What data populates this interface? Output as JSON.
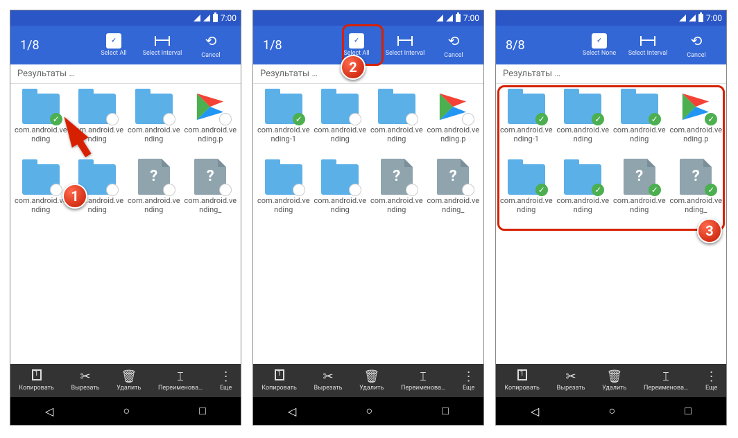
{
  "status": {
    "time": "7:00"
  },
  "toolbar": {
    "select_all": "Select All",
    "select_none": "Select None",
    "select_interval": "Select Interval",
    "cancel": "Cancel"
  },
  "breadcrumb": "Результаты …",
  "bottom": {
    "copy": "Копировать",
    "cut": "Вырезать",
    "delete": "Удалить",
    "rename": "Переименова…",
    "more": "Еще"
  },
  "callouts": {
    "one": "1",
    "two": "2",
    "three": "3"
  },
  "screens": [
    {
      "count": "1/8",
      "select_mode": "all",
      "items": [
        {
          "type": "folder",
          "selected": true,
          "label": "com.android.vending"
        },
        {
          "type": "folder",
          "selected": false,
          "label": "com.android.vending"
        },
        {
          "type": "folder",
          "selected": false,
          "label": "com.android.vending"
        },
        {
          "type": "play",
          "selected": false,
          "label": "com.android.vending.p"
        },
        {
          "type": "folder",
          "selected": false,
          "label": "com.android.vending"
        },
        {
          "type": "folder",
          "selected": false,
          "label": "com.android.vending"
        },
        {
          "type": "file",
          "selected": false,
          "label": "com.android.vending"
        },
        {
          "type": "file",
          "selected": false,
          "label": "com.android.vending_"
        }
      ]
    },
    {
      "count": "1/8",
      "select_mode": "all",
      "items": [
        {
          "type": "folder",
          "selected": true,
          "label": "com.android.vending-1"
        },
        {
          "type": "folder",
          "selected": false,
          "label": "com.android.vending"
        },
        {
          "type": "folder",
          "selected": false,
          "label": "com.android.vending"
        },
        {
          "type": "play",
          "selected": false,
          "label": "com.android.vending.p"
        },
        {
          "type": "folder",
          "selected": false,
          "label": "com.android.vending"
        },
        {
          "type": "folder",
          "selected": false,
          "label": "com.android.vending"
        },
        {
          "type": "file",
          "selected": false,
          "label": "com.android.vending"
        },
        {
          "type": "file",
          "selected": false,
          "label": "com.android.vending_"
        }
      ]
    },
    {
      "count": "8/8",
      "select_mode": "none",
      "items": [
        {
          "type": "folder",
          "selected": true,
          "label": "com.android.vending-1"
        },
        {
          "type": "folder",
          "selected": true,
          "label": "com.android.vending"
        },
        {
          "type": "folder",
          "selected": true,
          "label": "com.android.vending"
        },
        {
          "type": "play",
          "selected": true,
          "label": "com.android.vending.p"
        },
        {
          "type": "folder",
          "selected": true,
          "label": "com.android.vending"
        },
        {
          "type": "folder",
          "selected": true,
          "label": "com.android.vending"
        },
        {
          "type": "file",
          "selected": true,
          "label": "com.android.vending"
        },
        {
          "type": "file",
          "selected": true,
          "label": "com.android.vending_"
        }
      ]
    }
  ]
}
